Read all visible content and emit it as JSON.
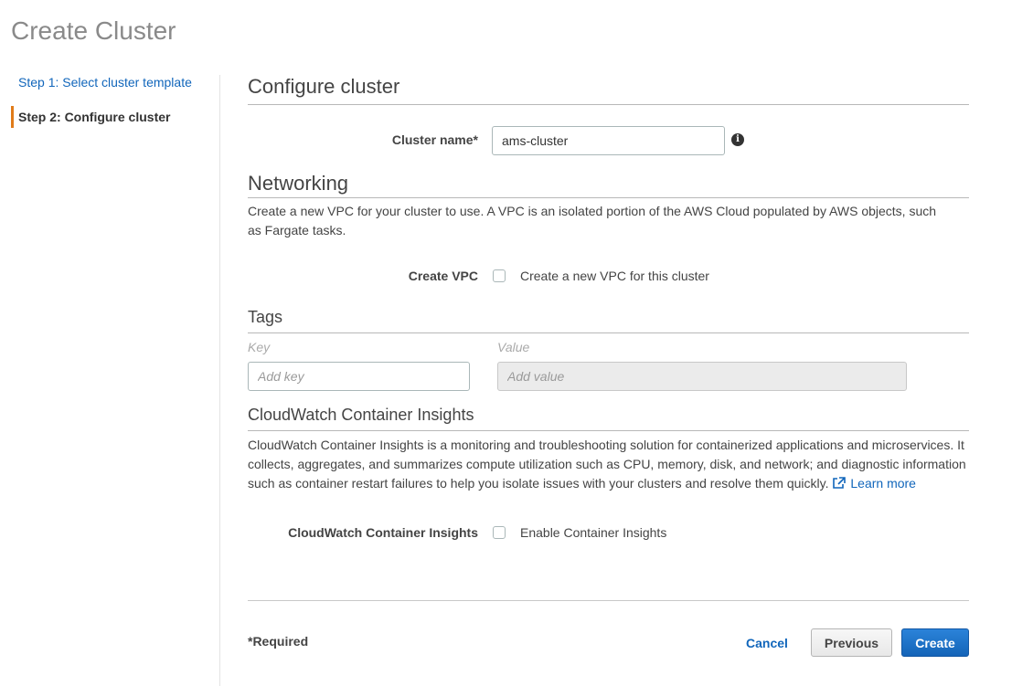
{
  "page": {
    "title": "Create Cluster"
  },
  "sidebar": {
    "steps": [
      {
        "label": "Step 1: Select cluster template",
        "active": false
      },
      {
        "label": "Step 2: Configure cluster",
        "active": true
      }
    ]
  },
  "configure": {
    "heading": "Configure cluster",
    "cluster_name_label": "Cluster name*",
    "cluster_name_value": "ams-cluster",
    "info_icon": "info-icon"
  },
  "networking": {
    "heading": "Networking",
    "description": "Create a new VPC for your cluster to use. A VPC is an isolated portion of the AWS Cloud populated by AWS objects, such as Fargate tasks.",
    "create_vpc_label": "Create VPC",
    "create_vpc_option": "Create a new VPC for this cluster",
    "create_vpc_checked": false
  },
  "tags": {
    "heading": "Tags",
    "key_column": "Key",
    "value_column": "Value",
    "key_placeholder": "Add key",
    "value_placeholder": "Add value"
  },
  "cloudwatch": {
    "heading": "CloudWatch Container Insights",
    "description": "CloudWatch Container Insights is a monitoring and troubleshooting solution for containerized applications and microservices. It collects, aggregates, and summarizes compute utilization such as CPU, memory, disk, and network; and diagnostic information such as container restart failures to help you isolate issues with your clusters and resolve them quickly.",
    "learn_more": "Learn more",
    "setting_label": "CloudWatch Container Insights",
    "enable_option": "Enable Container Insights",
    "enable_checked": false
  },
  "footer": {
    "required_note": "*Required",
    "cancel_label": "Cancel",
    "previous_label": "Previous",
    "create_label": "Create"
  },
  "colors": {
    "primary": "#1464b8",
    "link": "#1166bb",
    "active_step_accent": "#e07b1a"
  }
}
